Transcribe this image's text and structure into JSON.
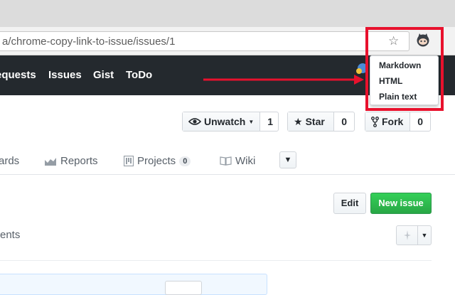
{
  "browser": {
    "url": "a/chrome-copy-link-to-issue/issues/1",
    "star_icon": "☆",
    "extension_icon": "octocat-icon"
  },
  "header_nav": {
    "items": [
      "equests",
      "Issues",
      "Gist",
      "ToDo"
    ]
  },
  "popup": {
    "items": [
      "Markdown",
      "HTML",
      "Plain text"
    ]
  },
  "repo_actions": {
    "unwatch_label": "Unwatch",
    "unwatch_count": "1",
    "star_label": "Star",
    "star_count": "0",
    "fork_label": "Fork",
    "fork_count": "0"
  },
  "repo_nav": {
    "boards": "ards",
    "reports": "Reports",
    "projects": "Projects",
    "projects_count": "0",
    "wiki": "Wiki"
  },
  "issue_actions": {
    "edit_label": "Edit",
    "new_issue_label": "New issue"
  },
  "comments_text": "ents",
  "colors": {
    "header_bg": "#24292e",
    "highlight": "#e8112d",
    "primary_green": "#28a745"
  }
}
